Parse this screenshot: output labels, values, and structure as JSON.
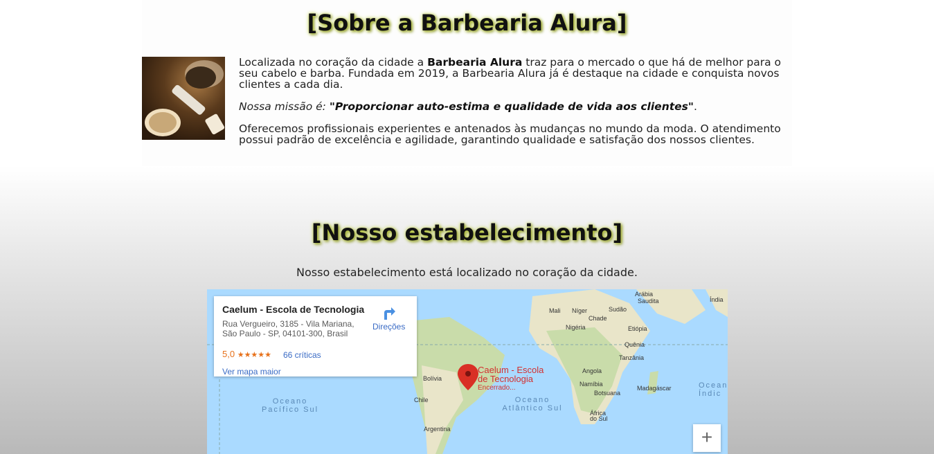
{
  "about": {
    "title": "[Sobre a Barbearia Alura]",
    "p1_a": "Localizada no coração da cidade a ",
    "p1_bold": "Barbearia Alura",
    "p1_b": " traz para o mercado o que há de melhor para o seu cabelo e barba. Fundada em 2019, a Barbearia Alura já é destaque na cidade e conquista novos clientes a cada dia.",
    "mission_label": "Nossa missão é: ",
    "mission_quote": "\"Proporcionar auto-estima e qualidade de vida aos clientes\"",
    "mission_end": ".",
    "p3": "Oferecemos profissionais experientes e antenados às mudanças no mundo da moda. O atendimento possui padrão de excelência e agilidade, garantindo qualidade e satisfação dos nossos clientes."
  },
  "establishment": {
    "title": "[Nosso estabelecimento]",
    "description": "Nosso estabelecimento está localizado no coração da cidade."
  },
  "map": {
    "place_name": "Caelum - Escola de Tecnologia",
    "address_line1": "Rua Vergueiro, 3185 - Vila Mariana,",
    "address_line2": "São Paulo - SP, 04101-300, Brasil",
    "rating": "5,0",
    "stars": "★★★★★",
    "reviews": "66 críticas",
    "larger_map": "Ver mapa maior",
    "directions": "Direções",
    "pin_line1": "Caelum - Escola",
    "pin_line2": "de Tecnologia",
    "pin_status": "Encerrado...",
    "zoom_in": "+",
    "labels": {
      "arabia": "Arábia",
      "saudita": "Saudita",
      "india": "Índia",
      "mali": "Mali",
      "niger": "Níger",
      "sudao": "Sudão",
      "chade": "Chade",
      "nigeria": "Nigéria",
      "etiopia": "Etiópia",
      "quenia": "Quênia",
      "tanzania": "Tanzânia",
      "angola": "Angola",
      "namibia": "Namíbia",
      "botsuana": "Botsuana",
      "madagascar": "Madagáscar",
      "africa": "África",
      "do_sul": "do Sul",
      "bolivia": "Bolívia",
      "chile": "Chile",
      "argentina": "Argentina",
      "pacific1": "Oceano",
      "pacific2": "Pacífico Sul",
      "atlantic1": "Oceano",
      "atlantic2": "Atlântico Sul",
      "indian1": "Ocean",
      "indian2": "Índic"
    }
  }
}
